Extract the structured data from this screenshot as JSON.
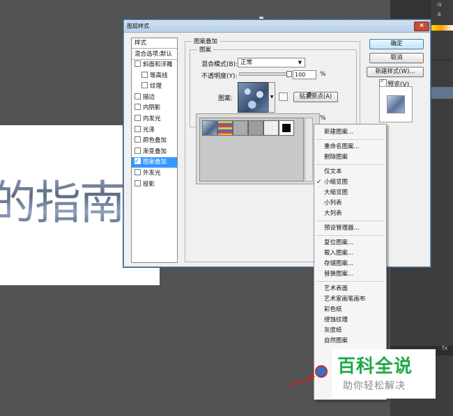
{
  "canvas": {
    "text": "的指南"
  },
  "dialog": {
    "title": "图层样式",
    "close_glyph": "×",
    "styles_header": "样式",
    "blend_options": "混合选项:默认",
    "styles": [
      {
        "label": "斜面和浮雕",
        "checked": false,
        "sub": false,
        "selected": false
      },
      {
        "label": "等高线",
        "checked": false,
        "sub": true,
        "selected": false
      },
      {
        "label": "纹理",
        "checked": false,
        "sub": true,
        "selected": false
      },
      {
        "label": "描边",
        "checked": false,
        "sub": false,
        "selected": false
      },
      {
        "label": "内阴影",
        "checked": false,
        "sub": false,
        "selected": false
      },
      {
        "label": "内发光",
        "checked": false,
        "sub": false,
        "selected": false
      },
      {
        "label": "光泽",
        "checked": false,
        "sub": false,
        "selected": false
      },
      {
        "label": "颜色叠加",
        "checked": false,
        "sub": false,
        "selected": false
      },
      {
        "label": "渐变叠加",
        "checked": false,
        "sub": false,
        "selected": false
      },
      {
        "label": "图案叠加",
        "checked": true,
        "sub": false,
        "selected": true
      },
      {
        "label": "外发光",
        "checked": false,
        "sub": false,
        "selected": false
      },
      {
        "label": "投影",
        "checked": false,
        "sub": false,
        "selected": false
      }
    ],
    "section_title": "图案叠加",
    "subsection_title": "图案",
    "blend_mode_label": "混合模式(B):",
    "blend_mode_value": "正常",
    "opacity_label": "不透明度(Y):",
    "opacity_value": "100",
    "opacity_percent": 100,
    "percent_sign": "%",
    "percent_sign_2": "%",
    "pattern_label": "图案:",
    "snap_origin_button": "贴紧原点(A)",
    "ok_button": "确定",
    "cancel_button": "取消",
    "new_style_button": "新建样式(W)...",
    "preview_label": "预览(V)",
    "preview_checked": true,
    "picker_gear": "⚙"
  },
  "menu": {
    "items": [
      {
        "label": "新建图案...",
        "sep_after": true
      },
      {
        "label": "重命名图案..."
      },
      {
        "label": "删除图案",
        "sep_after": true
      },
      {
        "label": "仅文本"
      },
      {
        "label": "小缩览图",
        "checked": true
      },
      {
        "label": "大缩览图"
      },
      {
        "label": "小列表"
      },
      {
        "label": "大列表",
        "sep_after": true
      },
      {
        "label": "预设管理器...",
        "sep_after": true
      },
      {
        "label": "复位图案..."
      },
      {
        "label": "载入图案..."
      },
      {
        "label": "存储图案..."
      },
      {
        "label": "替换图案...",
        "sep_after": true
      },
      {
        "label": "艺术表面"
      },
      {
        "label": "艺术家画笔画布"
      },
      {
        "label": "彩色纸"
      },
      {
        "label": "侵蚀纹理"
      },
      {
        "label": "灰度纸"
      },
      {
        "label": "自然图案"
      }
    ],
    "check_glyph": "✓"
  },
  "watermark": {
    "title": "百科全说",
    "subtitle": "助你轻松解决"
  },
  "right_panel": {
    "letters": [
      "G",
      "B"
    ],
    "fx": "fx"
  }
}
